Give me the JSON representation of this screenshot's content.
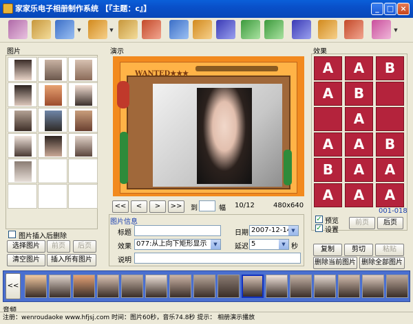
{
  "window": {
    "title": "家家乐电子相册制作系统  【『主题：c』】",
    "minimize": "_",
    "maximize": "□",
    "close": "×"
  },
  "panels": {
    "pictures": "图片",
    "preview": "演示",
    "effects": "效果",
    "picture_info": "图片信息",
    "music": "音频"
  },
  "left": {
    "delete_after_insert": "图片插入后删除",
    "select_button": "选择图片",
    "prev_button": "前页",
    "next_button": "后页",
    "clear_button": "清空图片",
    "insert_all_button": "插入所有图片"
  },
  "stage": {
    "banner": "WANTED★★★"
  },
  "nav": {
    "first": "<<",
    "prev": "<",
    "next": ">",
    "last": ">>",
    "goto_label": "到",
    "frame_label": "幅",
    "counter": "10/12",
    "resolution": "480x640"
  },
  "info": {
    "title_label": "标题",
    "title_value": "",
    "date_label": "日期",
    "date_value": "2007-12-14",
    "effect_label": "效果",
    "effect_value": "077:从上向下矩形显示",
    "delay_label": "延迟",
    "delay_value": "5",
    "seconds_label": "秒",
    "desc_label": "说明",
    "desc_value": ""
  },
  "effects": {
    "tiles": [
      "A",
      "A",
      "B",
      "A",
      "B",
      "",
      "",
      "A",
      "",
      "A",
      "A",
      "B",
      "B",
      "A",
      "A",
      "A",
      "A",
      "A"
    ],
    "range": "001-018",
    "preview_label": "预览",
    "settings_label": "设置",
    "prev_button": "前页",
    "next_button": "后页",
    "copy_button": "复制",
    "cut_button": "剪切",
    "paste_button": "粘贴",
    "delete_current_button": "删除当前图片",
    "delete_all_button": "删除全部图片"
  },
  "filmstrip": {
    "scroll_left": "<<"
  },
  "status": {
    "text": "注册：wenroudaoke  www.hfjsj.com 时间：图片60秒，音乐74.8秒   提示：  相册演示播放"
  },
  "colors": {
    "titlebar": "#0a5fd9",
    "stage_bg": "#f28a1e",
    "effect_tile": "#b4233c",
    "filmstrip": "#4a6fd0"
  }
}
